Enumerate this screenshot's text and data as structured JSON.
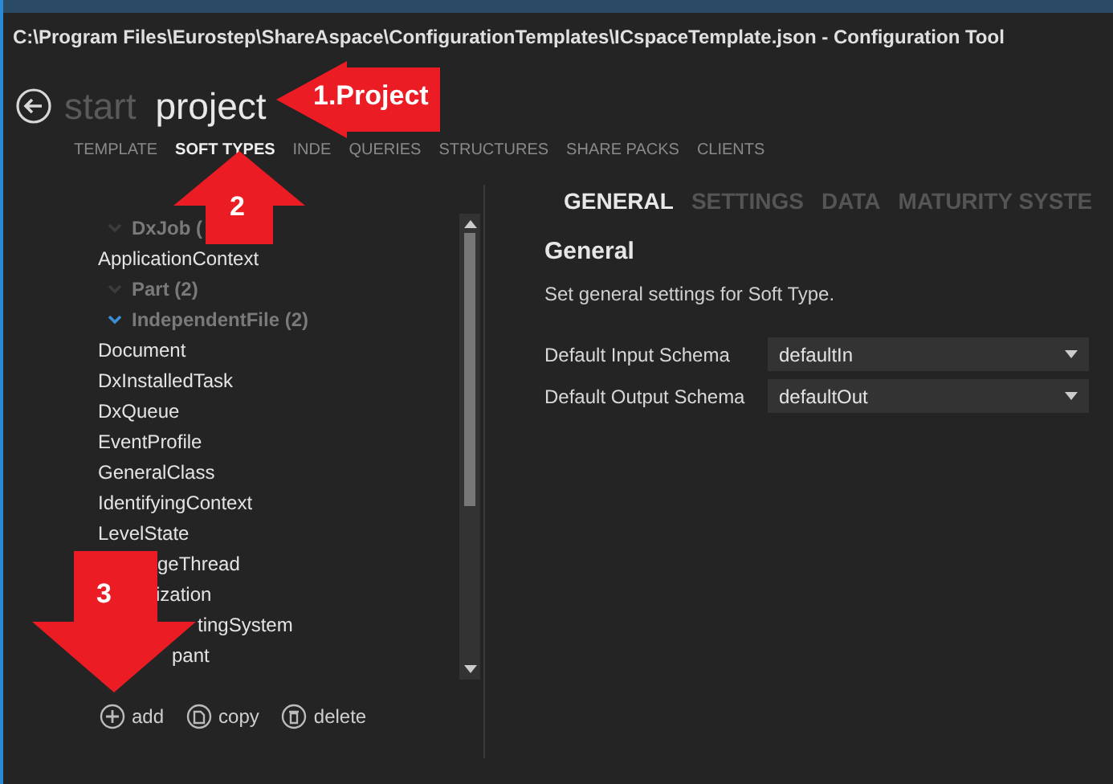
{
  "window": {
    "title": "C:\\Program Files\\Eurostep\\ShareAspace\\ConfigurationTemplates\\ICspaceTemplate.json - Configuration Tool"
  },
  "breadcrumb": [
    {
      "label": "start",
      "selected": false
    },
    {
      "label": "project",
      "selected": true
    }
  ],
  "tabs": [
    {
      "label": "TEMPLATE",
      "selected": false
    },
    {
      "label": "SOFT TYPES",
      "selected": true
    },
    {
      "label": "INDE",
      "selected": false
    },
    {
      "label": "QUERIES",
      "selected": false
    },
    {
      "label": "STRUCTURES",
      "selected": false
    },
    {
      "label": "SHARE PACKS",
      "selected": false
    },
    {
      "label": "CLIENTS",
      "selected": false
    }
  ],
  "soft_types": [
    {
      "kind": "group",
      "label": "DxJob (",
      "active": false
    },
    {
      "kind": "item",
      "label": "ApplicationContext"
    },
    {
      "kind": "group",
      "label": "Part (2)",
      "active": false
    },
    {
      "kind": "group",
      "label": "IndependentFile (2)",
      "active": true
    },
    {
      "kind": "item",
      "label": "Document"
    },
    {
      "kind": "item",
      "label": "DxInstalledTask"
    },
    {
      "kind": "item",
      "label": "DxQueue"
    },
    {
      "kind": "item",
      "label": "EventProfile"
    },
    {
      "kind": "item",
      "label": "GeneralClass"
    },
    {
      "kind": "item",
      "label": "IdentifyingContext"
    },
    {
      "kind": "item",
      "label": "LevelState"
    },
    {
      "kind": "item",
      "label": "geThread"
    },
    {
      "kind": "item",
      "label": "ization"
    },
    {
      "kind": "item",
      "label": "tingSystem"
    },
    {
      "kind": "item",
      "label": "pant"
    }
  ],
  "actions": [
    {
      "kind": "add",
      "label": "add"
    },
    {
      "kind": "copy",
      "label": "copy"
    },
    {
      "kind": "delete",
      "label": "delete"
    }
  ],
  "detail_tabs": [
    {
      "label": "GENERAL",
      "selected": true
    },
    {
      "label": "SETTINGS",
      "selected": false
    },
    {
      "label": "DATA",
      "selected": false
    },
    {
      "label": "MATURITY SYSTE",
      "selected": false
    }
  ],
  "section": {
    "title": "General",
    "description": "Set general settings for Soft Type."
  },
  "fields": [
    {
      "label": "Default Input Schema",
      "value": "defaultIn"
    },
    {
      "label": "Default Output Schema",
      "value": "defaultOut"
    }
  ],
  "annotations": [
    {
      "kind": "left",
      "text": "1.Project"
    },
    {
      "kind": "up",
      "text": "2"
    },
    {
      "kind": "down",
      "text": "3"
    }
  ]
}
